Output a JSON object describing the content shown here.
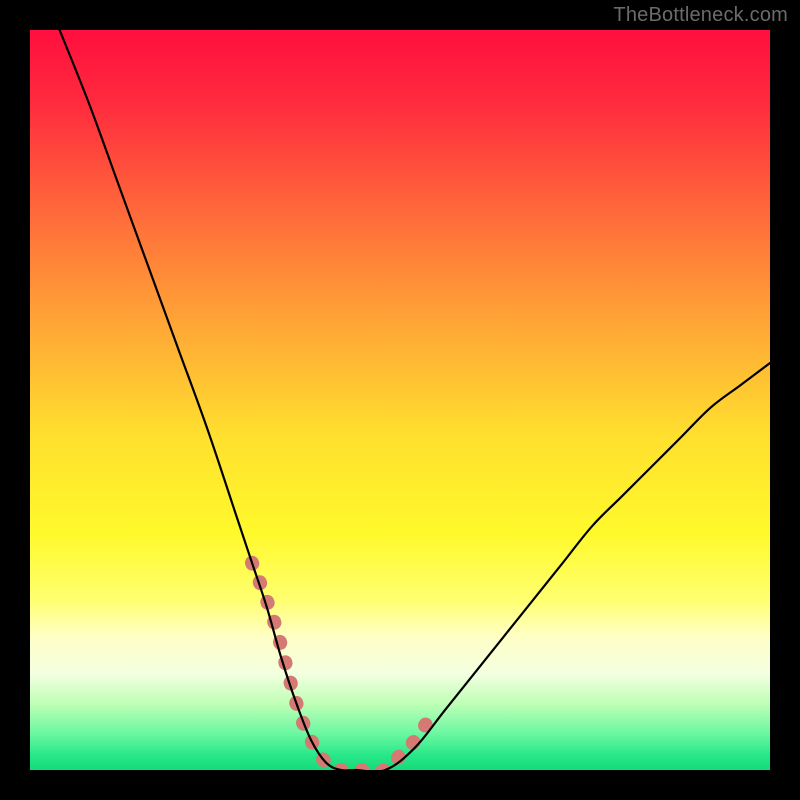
{
  "watermark": "TheBottleneck.com",
  "chart_data": {
    "type": "line",
    "title": "",
    "xlabel": "",
    "ylabel": "",
    "xlim": [
      0,
      100
    ],
    "ylim": [
      0,
      100
    ],
    "series": [
      {
        "name": "curve",
        "x": [
          4,
          8,
          12,
          16,
          20,
          24,
          28,
          30,
          32,
          34,
          36,
          38,
          40,
          42,
          44,
          48,
          52,
          56,
          60,
          64,
          68,
          72,
          76,
          80,
          84,
          88,
          92,
          96,
          100
        ],
        "y": [
          100,
          90,
          79,
          68,
          57,
          46,
          34,
          28,
          22,
          15,
          9,
          4,
          1,
          0,
          0,
          0,
          3,
          8,
          13,
          18,
          23,
          28,
          33,
          37,
          41,
          45,
          49,
          52,
          55
        ]
      }
    ],
    "highlight": {
      "name": "trough-highlight",
      "x": [
        30,
        33,
        36,
        38,
        40,
        42,
        44,
        48,
        50,
        52,
        54
      ],
      "y": [
        28,
        20,
        9,
        4,
        1,
        0,
        0,
        0,
        2,
        4,
        7
      ]
    },
    "gradient_stops": [
      {
        "offset": 0.0,
        "color": "#ff0f3e"
      },
      {
        "offset": 0.1,
        "color": "#ff2b3e"
      },
      {
        "offset": 0.25,
        "color": "#ff6b3a"
      },
      {
        "offset": 0.4,
        "color": "#ffa736"
      },
      {
        "offset": 0.55,
        "color": "#ffe02e"
      },
      {
        "offset": 0.68,
        "color": "#fff92b"
      },
      {
        "offset": 0.77,
        "color": "#ffff70"
      },
      {
        "offset": 0.82,
        "color": "#ffffc6"
      },
      {
        "offset": 0.87,
        "color": "#f3ffe0"
      },
      {
        "offset": 0.91,
        "color": "#bfffb6"
      },
      {
        "offset": 0.95,
        "color": "#6cf8a2"
      },
      {
        "offset": 0.98,
        "color": "#28e888"
      },
      {
        "offset": 1.0,
        "color": "#15db7a"
      }
    ],
    "highlight_color": "#d47a73",
    "curve_color": "#000000"
  }
}
